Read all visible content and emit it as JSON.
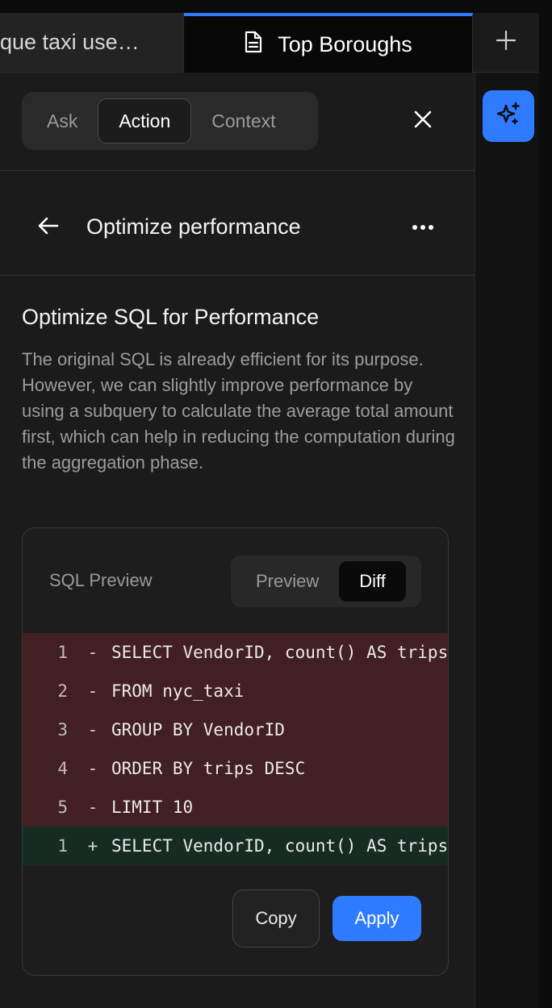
{
  "tabs": [
    {
      "label": "ique taxi use…",
      "active": false
    },
    {
      "label": "Top Boroughs",
      "active": true
    }
  ],
  "assistant": {
    "modes": [
      "Ask",
      "Action",
      "Context"
    ],
    "active_mode": "Action"
  },
  "nav": {
    "title": "Optimize performance"
  },
  "content": {
    "heading": "Optimize SQL for Performance",
    "description": "The original SQL is already efficient for its purpose. However, we can slightly improve performance by using a subquery to calculate the average total amount first, which can help in reducing the computation during the aggregation phase."
  },
  "preview": {
    "title": "SQL Preview",
    "toggle": [
      "Preview",
      "Diff"
    ],
    "active_toggle": "Diff",
    "diff_lines": [
      {
        "num": "1",
        "sign": "-",
        "text": "SELECT VendorID, count() AS trips",
        "type": "del"
      },
      {
        "num": "2",
        "sign": "-",
        "text": "FROM nyc_taxi",
        "type": "del"
      },
      {
        "num": "3",
        "sign": "-",
        "text": "GROUP BY VendorID",
        "type": "del"
      },
      {
        "num": "4",
        "sign": "-",
        "text": "ORDER BY trips DESC",
        "type": "del"
      },
      {
        "num": "5",
        "sign": "-",
        "text": "LIMIT 10",
        "type": "del"
      },
      {
        "num": "1",
        "sign": "+",
        "text": "SELECT VendorID, count() AS trips",
        "type": "add"
      }
    ],
    "copy_label": "Copy",
    "apply_label": "Apply"
  },
  "colors": {
    "accent": "#2f7bff",
    "panel_bg": "#1b1b1b",
    "diff_removed": "#421f20",
    "diff_added": "#162c22"
  },
  "icons": [
    "document-icon",
    "plus-icon",
    "sparkles-icon",
    "close-icon",
    "arrow-left-icon",
    "more-horizontal-icon"
  ]
}
